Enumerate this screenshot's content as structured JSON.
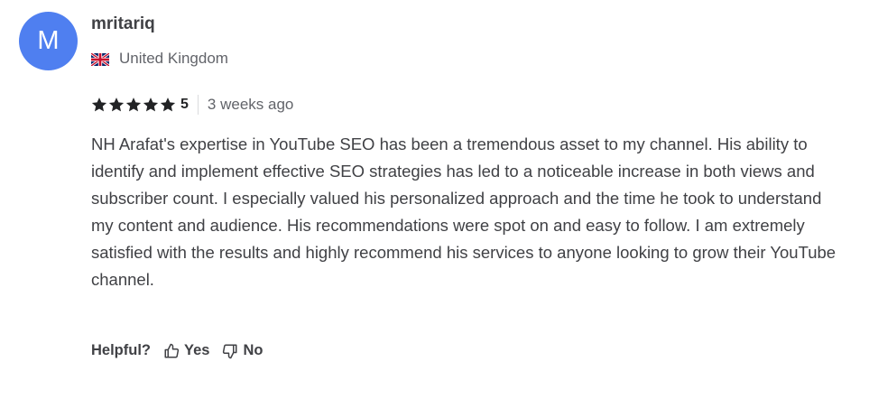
{
  "review": {
    "avatar_letter": "M",
    "avatar_color": "#4f7ff0",
    "username": "mritariq",
    "country": "United Kingdom",
    "country_flag_icon": "uk-flag-icon",
    "rating": 5,
    "rating_label": "5",
    "time_ago": "3 weeks ago",
    "text": "NH Arafat's expertise in YouTube SEO has been a tremendous asset to my channel. His ability to identify and implement effective SEO strategies has led to a noticeable increase in both views and subscriber count. I especially valued his personalized approach and the time he took to understand my content and audience. His recommendations were spot on and easy to follow. I am extremely satisfied with the results and highly recommend his services to anyone looking to grow their YouTube channel."
  },
  "helpful": {
    "label": "Helpful?",
    "yes_label": "Yes",
    "no_label": "No",
    "yes_icon": "thumbs-up-icon",
    "no_icon": "thumbs-down-icon"
  },
  "colors": {
    "star": "#222325",
    "text": "#404145",
    "muted": "#62646a"
  }
}
